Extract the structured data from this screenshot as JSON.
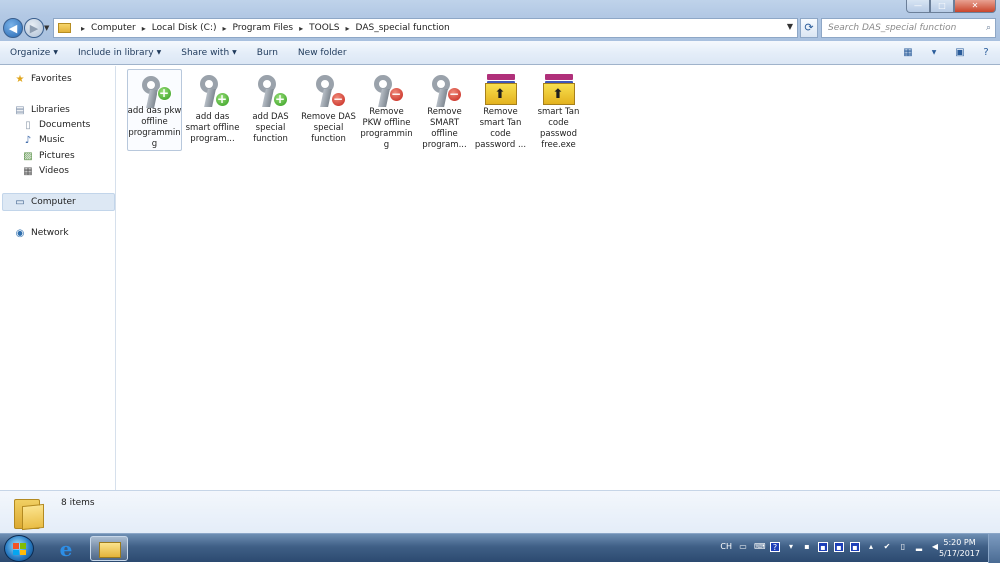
{
  "window": {
    "minimize_glyph": "—",
    "maximize_glyph": "□",
    "close_glyph": "✕"
  },
  "address": {
    "path": [
      "Computer",
      "Local Disk (C:)",
      "Program Files",
      "TOOLS",
      "DAS_special function"
    ],
    "separator": "▸"
  },
  "search": {
    "placeholder": "Search DAS_special function"
  },
  "toolbar": {
    "items": [
      "Organize",
      "Include in library",
      "Share with",
      "Burn",
      "New folder"
    ]
  },
  "sidebar": {
    "favorites": "Favorites",
    "libraries": "Libraries",
    "library_items": [
      "Documents",
      "Music",
      "Pictures",
      "Videos"
    ],
    "computer": "Computer",
    "network": "Network"
  },
  "files": [
    {
      "label": "add das pkw offline programming",
      "icon": "key-add-icon"
    },
    {
      "label": "add das smart offline program...",
      "icon": "key-add-icon"
    },
    {
      "label": "add DAS special function",
      "icon": "key-add-icon"
    },
    {
      "label": "Remove DAS special function",
      "icon": "key-remove-icon"
    },
    {
      "label": "Remove PKW offline programming",
      "icon": "key-remove-icon"
    },
    {
      "label": "Remove SMART offline program...",
      "icon": "key-remove-icon"
    },
    {
      "label": "Remove smart Tan code password ...",
      "icon": "winrar-icon"
    },
    {
      "label": "smart Tan code passwod free.exe",
      "icon": "winrar-icon"
    }
  ],
  "details": {
    "count": "8 items"
  },
  "taskbar": {
    "lang": "CH",
    "time": "5:20 PM",
    "date": "5/17/2017"
  },
  "colors": {
    "accent": "#2466b1",
    "add_badge": "#2f9a1c",
    "remove_badge": "#c4231a"
  }
}
